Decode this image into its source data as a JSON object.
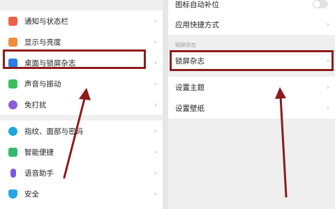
{
  "left": {
    "group1": [
      {
        "label": "通知与状态栏",
        "icon": "notification-icon",
        "color": "#f06048"
      },
      {
        "label": "显示与亮度",
        "icon": "display-brightness-icon",
        "color": "#ef8b3d"
      },
      {
        "label": "桌面与锁屏杂志",
        "icon": "desktop-lockscreen-icon",
        "color": "#2d7de6"
      },
      {
        "label": "声音与振动",
        "icon": "sound-vibration-icon",
        "color": "#3cbf5a"
      },
      {
        "label": "免打扰",
        "icon": "do-not-disturb-icon",
        "color": "#8a5cd6"
      }
    ],
    "group2": [
      {
        "label": "指纹、面部与密码",
        "icon": "fingerprint-icon",
        "color": "#1fa8d8"
      },
      {
        "label": "智能便捷",
        "icon": "smart-assist-icon",
        "color": "#35b86a"
      },
      {
        "label": "语音助手",
        "icon": "voice-assistant-icon",
        "color": "#7b5be0"
      },
      {
        "label": "安全",
        "icon": "security-icon",
        "color": "#27a5e3"
      }
    ]
  },
  "right": {
    "top_rows": [
      {
        "label": "图标自动补位",
        "control": "toggle"
      },
      {
        "label": "应用快捷方式",
        "control": "chevron"
      }
    ],
    "section_header": "锁屏杂志",
    "lock_rows": [
      {
        "label": "锁屏杂志"
      }
    ],
    "bottom_rows": [
      {
        "label": "设置主题"
      },
      {
        "label": "设置壁纸"
      }
    ]
  },
  "chevron_glyph": "›",
  "colors": {
    "highlight": "#8c1b1b",
    "arrow": "#8c1b1b"
  }
}
